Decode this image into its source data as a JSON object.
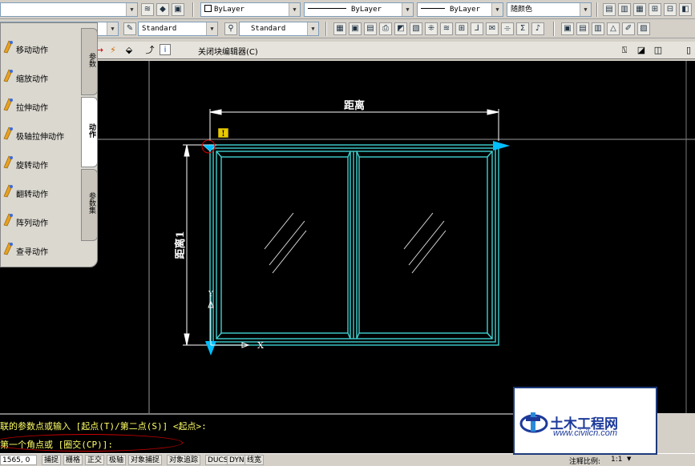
{
  "toolbar_top": {
    "layer_linetype": "ByLayer",
    "linetype_line1": "ByLayer",
    "linetype_line2": "ByLayer",
    "color_combo": "随颜色"
  },
  "toolbar_second": {
    "text_style": "Standard",
    "dim_style": "Standard"
  },
  "block_editor": {
    "close_label": "关闭块编辑器(C)"
  },
  "palette": {
    "items": [
      {
        "label": "移动动作",
        "icon": "move-action-icon"
      },
      {
        "label": "缩放动作",
        "icon": "scale-action-icon"
      },
      {
        "label": "拉伸动作",
        "icon": "stretch-action-icon"
      },
      {
        "label": "极轴拉伸动作",
        "icon": "polar-stretch-action-icon"
      },
      {
        "label": "旋转动作",
        "icon": "rotate-action-icon"
      },
      {
        "label": "翻转动作",
        "icon": "flip-action-icon"
      },
      {
        "label": "阵列动作",
        "icon": "array-action-icon"
      },
      {
        "label": "查寻动作",
        "icon": "lookup-action-icon"
      }
    ],
    "tabs": [
      "参数",
      "动作",
      "参数集"
    ]
  },
  "drawing": {
    "dim_top_label": "距离",
    "dim_left_label": "距离1"
  },
  "command_line": {
    "line1": "联的参数点或输入 [起点(T)/第二点(S)] <起点>:",
    "line2": "第一个角点或 [圈交(CP)]:"
  },
  "status_bar": {
    "coords": "1565, 0",
    "buttons": [
      "捕捉",
      "栅格",
      "正交",
      "极轴",
      "对象捕捉",
      "对象追踪",
      "DUCS",
      "DYN",
      "线宽"
    ],
    "annotation_scale_label": "注释比例:",
    "annotation_scale_value": "1:1"
  },
  "watermark": {
    "title": "土木工程网",
    "url": "www.civilcn.com"
  },
  "colors": {
    "canvas": "#000000",
    "window_frame": "#3fd0d0",
    "dimension": "#ffffff",
    "command_text": "#ffff66",
    "marker": "#00bfff"
  }
}
